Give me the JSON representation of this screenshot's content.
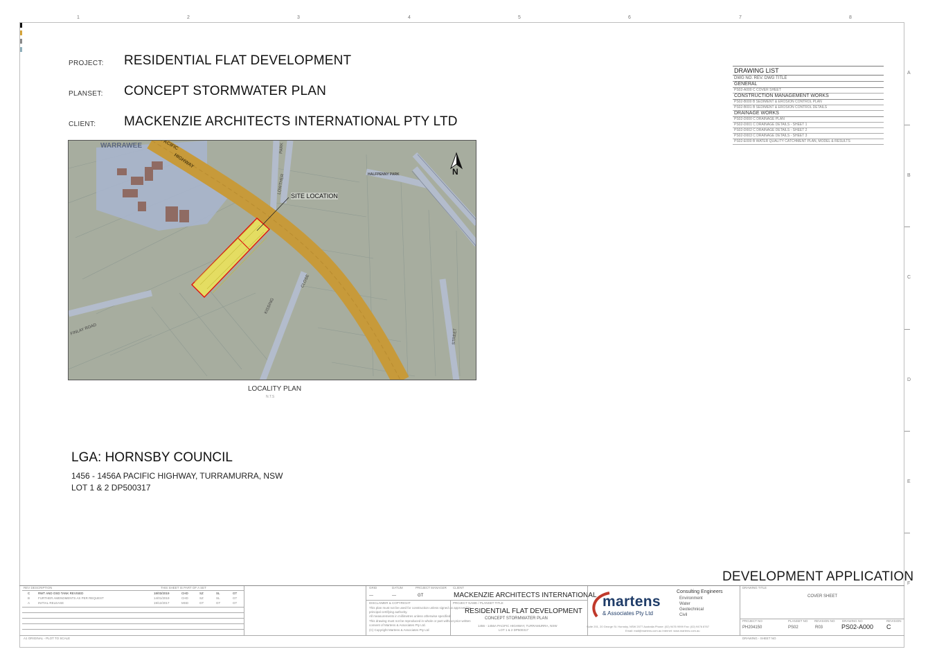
{
  "header": {
    "column_numbers": [
      "1",
      "2",
      "3",
      "4",
      "5",
      "6",
      "7",
      "8"
    ],
    "row_letters": [
      "A",
      "B",
      "C",
      "D",
      "E",
      "F"
    ]
  },
  "project": {
    "project_label": "PROJECT:",
    "project_value": "RESIDENTIAL FLAT DEVELOPMENT",
    "planset_label": "PLANSET:",
    "planset_value": "CONCEPT STORMWATER PLAN",
    "client_label": "CLIENT:",
    "client_value": "MACKENZIE ARCHITECTS INTERNATIONAL PTY LTD"
  },
  "drawing_list": {
    "title": "DRAWING LIST",
    "header_row": "DWG NO.  REV.  DWG TITLE",
    "sections": [
      {
        "name": "GENERAL",
        "rows": [
          "PS02-A000   C    COVER SHEET"
        ]
      },
      {
        "name": "CONSTRUCTION MANAGEMENT WORKS",
        "rows": [
          "PS02-B000   B    SEDIMENT & EROSION CONTROL PLAN",
          "PS02-B001   B    SEDIMENT & EROSION CONTROL DETAILS"
        ]
      },
      {
        "name": "DRAINAGE WORKS",
        "rows": [
          "PS02-D000   C    DRAINAGE PLAN",
          "PS02-D001   C    DRAINAGE DETAILS - SHEET 1",
          "PS02-D002   C    DRAINAGE DETAILS - SHEET 2",
          "PS02-D003   C    DRAINAGE DETAILS - SHEET 3",
          "PS02-E000   B    WATER QUALITY CATCHMENT PLAN, MODEL & RESULTS"
        ]
      }
    ]
  },
  "map": {
    "labels": {
      "warrawee": "WARRAWEE",
      "pacific": "PACIFIC",
      "highway": "HIGHWAY",
      "lowther": "LOWTHER",
      "park": "PARK",
      "halfpenny_park": "HALFPENNY PARK",
      "site_location": "SITE LOCATION",
      "close": "CLOSE",
      "kissing": "KISSING",
      "finlay_road": "FINLAY ROAD",
      "street": "STREET",
      "north": "N"
    },
    "caption": "LOCALITY PLAN",
    "caption_sub": "N.T.S",
    "colors": {
      "highway": "#c79a3a",
      "site": "#e8e26a",
      "site_outline": "#e01010",
      "road": "#b4bccb",
      "suburb": "#aab6d4"
    }
  },
  "lga": {
    "title": "LGA: HORNSBY COUNCIL",
    "address": "1456 - 1456A PACIFIC HIGHWAY, TURRAMURRA, NSW",
    "lots": "LOT 1 & 2 DP500317"
  },
  "title_block": {
    "stamp": "DEVELOPMENT APPLICATION",
    "rev_header": "REV   DESCRIPTION",
    "rev_rows": [
      {
        "rev": "C",
        "desc": "RWT AND OSD TANK REVISED",
        "date": "18/03/2019",
        "dr": "CHD",
        "des": "SZ",
        "chk": "SL",
        "appr": "GT"
      },
      {
        "rev": "B",
        "desc": "FURTHER AMENDMENTS AS PER REQUEST",
        "date": "14/01/2019",
        "dr": "CHD",
        "des": "SZ",
        "chk": "SL",
        "appr": "GT"
      },
      {
        "rev": "A",
        "desc": "INITIAL RELEASE",
        "date": "19/12/2017",
        "dr": "MSD",
        "des": "GT",
        "chk": "GT",
        "appr": "GT"
      }
    ],
    "scale_note": "THIS SHEET IS PART OF A SET",
    "grid_labels": [
      "GRID",
      "DATUM",
      "PROJECT MANAGER",
      "CLIENT"
    ],
    "grid_values": [
      "---",
      "---",
      "GT"
    ],
    "client_name": "MACKENZIE ARCHITECTS INTERNATIONAL",
    "disclaimer_title": "DISCLAIMER & COPYRIGHT",
    "disclaimer_lines": [
      "This plan must not be used for construction unless signed as approved by",
      "principal certifying authority.",
      "All measurements in millimetres unless otherwise specified.",
      "This drawing must not be reproduced in whole or part without prior written",
      "consent of Martens & Associates Pty Ltd.",
      "(C) Copyright Martens & Associates Pty Ltd"
    ],
    "project_name_label": "PROJECT NAME / PLANSET TITLE",
    "project_name": "RESIDENTIAL FLAT DEVELOPMENT",
    "planset_name": "CONCEPT STORMWATER PLAN",
    "project_address": "1456 - 1456A PACIFIC HIGHWAY, TURRAMURRA, NSW",
    "project_lots": "LOT 1 & 2 DP500317",
    "company": "martens",
    "company_sub": "& Associates Pty Ltd",
    "company_tag": "Consulting Engineers",
    "disciplines": [
      "Environment",
      "Water",
      "Geotechnical",
      "Civil"
    ],
    "company_contact": "Suite 201, 20 George St. Hornsby, NSW 2077 Australia  Phone: (02) 9476 9999  Fax: (02) 9476 8767",
    "company_web": "Email: mail@martens.com.au  Internet: www.martens.com.au",
    "drawing_title_label": "DRAWING TITLE",
    "drawing_title": "COVER SHEET",
    "field_labels": [
      "PROJECT NO",
      "PLANSET NO",
      "REVISION NO",
      "DRAWING NO",
      "REVISION"
    ],
    "project_no": "PH204150",
    "planset_no": "PS02",
    "revision_no": "R03",
    "drawing_no": "PS02-A000",
    "revision": "C",
    "footer_left": "A1 ORIGINAL - PLOT TO SCALE",
    "footer_right": "DRAWING - SHEET NO"
  }
}
